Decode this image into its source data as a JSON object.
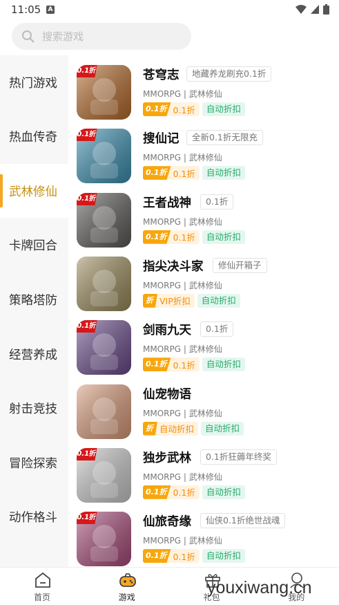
{
  "status_bar": {
    "time": "11:05"
  },
  "search": {
    "placeholder": "搜索游戏"
  },
  "categories": [
    "热门游戏",
    "热血传奇",
    "武林修仙",
    "卡牌回合",
    "策略塔防",
    "经营养成",
    "射击竞技",
    "冒险探索",
    "动作格斗"
  ],
  "active_category": "武林修仙",
  "games": [
    {
      "name": "苍穹志",
      "tag": "地藏养龙刷充0.1折",
      "meta": "MMORPG | 武林修仙",
      "disc_label": "0.1折",
      "disc_value": "0.1折",
      "auto": "自动折扣",
      "badge": "0.1折",
      "color": "#b56a2a"
    },
    {
      "name": "搜仙记",
      "tag": "全新0.1折无限充",
      "meta": "MMORPG | 武林修仙",
      "disc_label": "0.1折",
      "disc_value": "0.1折",
      "auto": "自动折扣",
      "badge": "0.1折",
      "color": "#3a8fb0"
    },
    {
      "name": "王者战神",
      "tag": "0.1折",
      "meta": "MMORPG | 武林修仙",
      "disc_label": "0.1折",
      "disc_value": "0.1折",
      "auto": "自动折扣",
      "badge": "0.1折",
      "color": "#5c5a58"
    },
    {
      "name": "指尖决斗家",
      "tag": "修仙开箱子",
      "meta": "MMORPG | 武林修仙",
      "disc_label": "折",
      "disc_value": "VIP折扣",
      "auto": "自动折扣",
      "badge": "",
      "color": "#9a8a5a"
    },
    {
      "name": "剑雨九天",
      "tag": "0.1折",
      "meta": "MMORPG | 武林修仙",
      "disc_label": "0.1折",
      "disc_value": "0.1折",
      "auto": "自动折扣",
      "badge": "0.1折",
      "color": "#6a4a8a"
    },
    {
      "name": "仙宠物语",
      "tag": "",
      "meta": "MMORPG | 武林修仙",
      "disc_label": "折",
      "disc_value": "自动折扣",
      "auto": "自动折扣",
      "badge": "",
      "color": "#d99a7a"
    },
    {
      "name": "独步武林",
      "tag": "0.1折狂薅年终奖",
      "meta": "MMORPG | 武林修仙",
      "disc_label": "0.1折",
      "disc_value": "0.1折",
      "auto": "自动折扣",
      "badge": "0.1折",
      "color": "#c9c9c9"
    },
    {
      "name": "仙旅奇缘",
      "tag": "仙侠0.1折绝世战魂",
      "meta": "MMORPG | 武林修仙",
      "disc_label": "0.1折",
      "disc_value": "0.1折",
      "auto": "自动折扣",
      "badge": "0.1折",
      "color": "#a84a7a"
    }
  ],
  "tabs": [
    {
      "label": "首页",
      "icon": "home-icon"
    },
    {
      "label": "游戏",
      "icon": "gamepad-icon"
    },
    {
      "label": "礼包",
      "icon": "gift-icon"
    },
    {
      "label": "我的",
      "icon": "user-icon"
    }
  ],
  "watermark": "youxiwang.cn"
}
